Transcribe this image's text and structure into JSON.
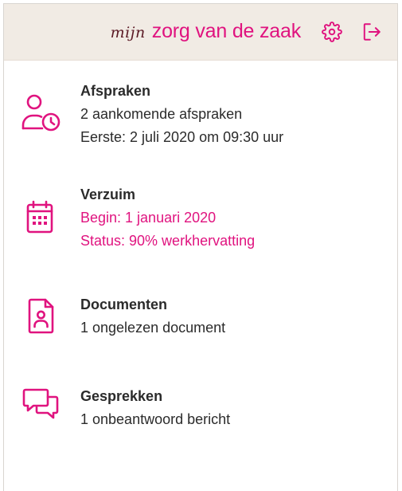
{
  "header": {
    "logo_prefix": "mijn",
    "logo_main": "zorg van de zaak",
    "settings_icon": "gear-icon",
    "logout_icon": "logout-icon"
  },
  "colors": {
    "accent": "#e0137f",
    "header_bg": "#f1ebe4",
    "logo_prefix": "#5b1a25",
    "text": "#2b2b2b"
  },
  "items": [
    {
      "icon": "user-clock-icon",
      "title": "Afspraken",
      "lines": [
        "2 aankomende afspraken",
        "Eerste: 2 juli 2020 om 09:30 uur"
      ]
    },
    {
      "icon": "calendar-icon",
      "title": "Verzuim",
      "lines": [
        "Begin: 1 januari 2020",
        "Status: 90% werkhervatting"
      ]
    },
    {
      "icon": "document-user-icon",
      "title": "Documenten",
      "lines": [
        "1 ongelezen document"
      ]
    },
    {
      "icon": "chat-bubbles-icon",
      "title": "Gesprekken",
      "lines": [
        "1 onbeantwoord bericht"
      ]
    }
  ]
}
